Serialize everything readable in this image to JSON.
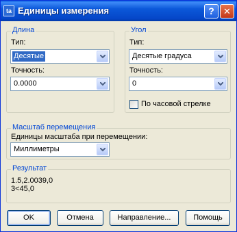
{
  "window": {
    "title": "Единицы измерения",
    "app_icon_text": "ta",
    "help_label": "?",
    "close_label": "✕"
  },
  "length": {
    "group_title": "Длина",
    "type_label": "Тип:",
    "type_value": "Десятые",
    "precision_label": "Точность:",
    "precision_value": "0.0000"
  },
  "angle": {
    "group_title": "Угол",
    "type_label": "Тип:",
    "type_value": "Десятые градуса",
    "precision_label": "Точность:",
    "precision_value": "0",
    "clockwise_label": "По часовой стрелке",
    "clockwise_checked": false
  },
  "insertion": {
    "group_title": "Масштаб перемещения",
    "units_label": "Единицы масштаба при перемещении:",
    "units_value": "Миллиметры"
  },
  "result": {
    "group_title": "Результат",
    "line1": "1.5,2.0039,0",
    "line2": "3<45,0"
  },
  "buttons": {
    "ok": "OK",
    "cancel": "Отмена",
    "direction": "Направление...",
    "help": "Помощь"
  },
  "colors": {
    "titlebar": "#0554d4",
    "group_title": "#0046d5",
    "selection": "#316ac5",
    "dialog_bg": "#ece9d8"
  },
  "icons": {
    "dropdown": "chevron-down-icon",
    "help": "question-icon",
    "close": "close-icon"
  }
}
